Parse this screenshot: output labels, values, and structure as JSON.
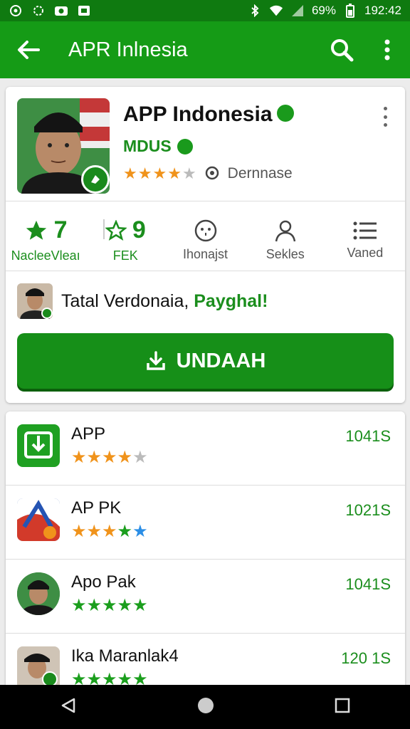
{
  "status_bar": {
    "battery": "69%",
    "time": "192:42"
  },
  "app_bar": {
    "title": "APR Inlnesia"
  },
  "app": {
    "name": "APP Indonesia",
    "developer": "MDUS",
    "rating_stars": 3.5,
    "meta_label": "Dernnase"
  },
  "stats": [
    {
      "value": "7",
      "label": "NacleeVleaı",
      "icon": "star-filled-icon"
    },
    {
      "value": "9",
      "label": "FEK",
      "icon": "star-outline-icon"
    },
    {
      "value": "",
      "label": "Ihonajst",
      "icon": "smile-face-icon"
    },
    {
      "value": "",
      "label": "Sekles",
      "icon": "person-icon"
    },
    {
      "value": "",
      "label": "Vaned",
      "icon": "list-icon"
    }
  ],
  "promo": {
    "text": "Tatal Verdonaia, ",
    "highlight": "Payghal!"
  },
  "install_button": {
    "label": "UNDAAH"
  },
  "related": [
    {
      "name": "APP",
      "count": "1041S",
      "stars": 4,
      "icon": "download-app-icon"
    },
    {
      "name": "AP PK",
      "count": "1021S",
      "stars": 5,
      "icon": "ap-pk-app-icon"
    },
    {
      "name": "Apo Pak",
      "count": "1041S",
      "stars": 5,
      "icon": "person-avatar-icon"
    },
    {
      "name": "Ika Maranlak4",
      "count": "120 1S",
      "stars": 5,
      "icon": "person-avatar-icon"
    }
  ],
  "colors": {
    "primary": "#159b16",
    "primary_dark": "#0f7a10",
    "accent_star": "#f0931b"
  }
}
